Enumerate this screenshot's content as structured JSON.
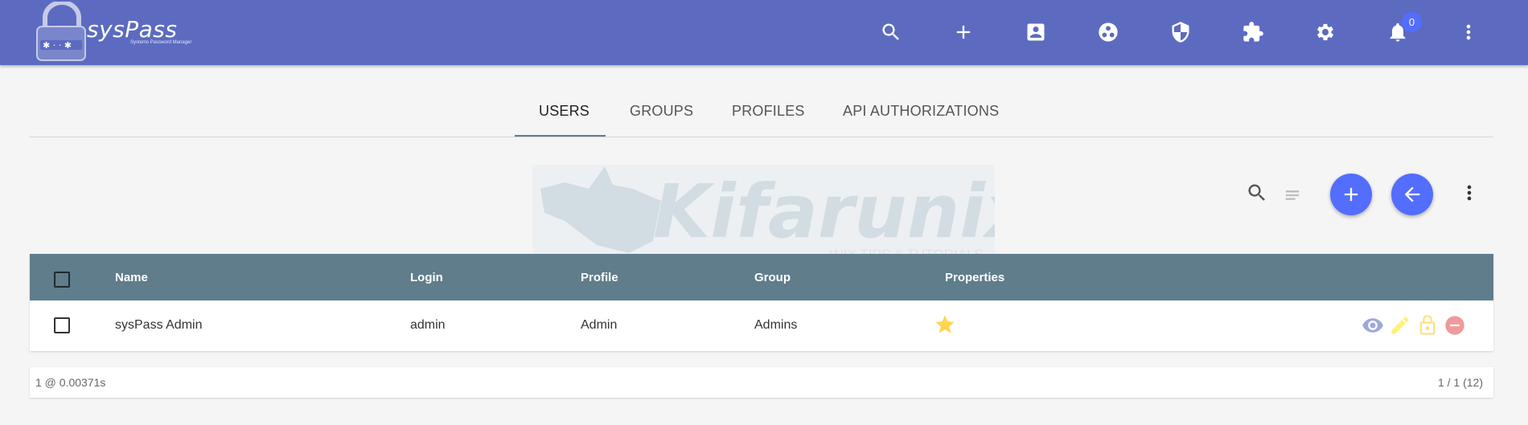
{
  "app": {
    "name": "sysPass",
    "subtitle": "Systems Password Manager"
  },
  "header": {
    "icons": [
      "search-icon",
      "add-icon",
      "account-box-icon",
      "group-icon",
      "security-shield-icon",
      "extension-icon",
      "settings-icon",
      "notifications-icon",
      "more-vert-icon"
    ],
    "notification_count": "0"
  },
  "tabs": [
    {
      "label": "USERS",
      "active": true
    },
    {
      "label": "GROUPS",
      "active": false
    },
    {
      "label": "PROFILES",
      "active": false
    },
    {
      "label": "API AUTHORIZATIONS",
      "active": false
    }
  ],
  "watermark": {
    "brand": "Kifarunix",
    "tagline": "*NIX TIPS & TUTORIALS"
  },
  "toolbar": {
    "icons": [
      "search-icon",
      "clear-filter-icon",
      "add-icon",
      "back-arrow-icon",
      "more-vert-icon"
    ]
  },
  "table": {
    "headers": {
      "name": "Name",
      "login": "Login",
      "profile": "Profile",
      "group": "Group",
      "properties": "Properties"
    },
    "rows": [
      {
        "name": "sysPass Admin",
        "login": "admin",
        "profile": "Admin",
        "group": "Admins",
        "properties_icon": "star-icon",
        "actions": [
          "view-icon",
          "edit-icon",
          "change-password-icon",
          "delete-icon"
        ]
      }
    ]
  },
  "footer": {
    "left": "1 @ 0.00371s",
    "right": "1 / 1 (12)"
  },
  "colors": {
    "header_bg": "#5c6bc0",
    "accent": "#536dfe",
    "table_header_bg": "#607d8b",
    "star": "#ffd54f",
    "view": "#9fa8da",
    "edit": "#fff176",
    "lock": "#ffe082",
    "delete": "#ef9a9a"
  }
}
